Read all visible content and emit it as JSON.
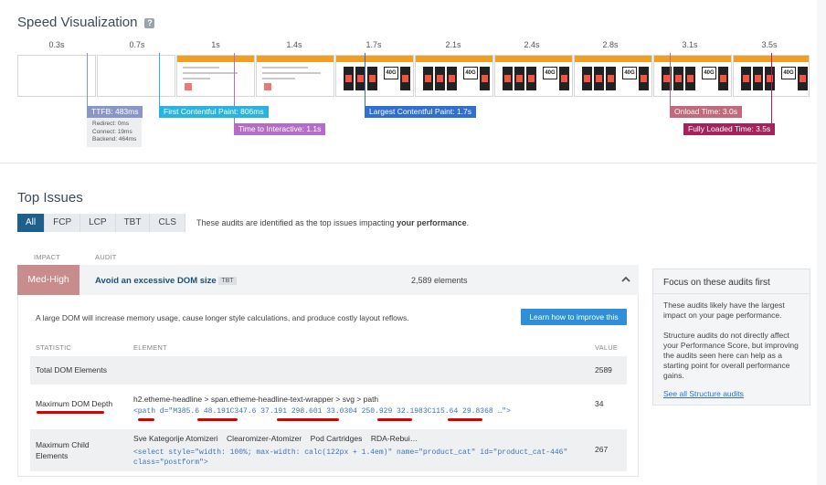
{
  "speed": {
    "title": "Speed Visualization",
    "help": "?",
    "ticks": [
      "0.3s",
      "0.7s",
      "1s",
      "1.4s",
      "1.7s",
      "2.1s",
      "2.4s",
      "2.8s",
      "3.1s",
      "3.5s"
    ],
    "ttfb": {
      "label": "TTFB: 483ms",
      "redirect": "Redirect: 0ms",
      "connect": "Connect: 19ms",
      "backend": "Backend: 464ms",
      "color": "#8a95c8"
    },
    "fcp": {
      "label": "First Contentful Paint: 806ms",
      "color": "#29b3e0"
    },
    "tti": {
      "label": "Time to Interactive: 1.1s",
      "color": "#b56cc8"
    },
    "lcp": {
      "label": "Largest Contentful Paint: 1.7s",
      "color": "#2f6fd1"
    },
    "onload": {
      "label": "Onload Time: 3.0s",
      "color": "#c26a7c"
    },
    "fully": {
      "label": "Fully Loaded Time: 3.5s",
      "color": "#a5235a"
    },
    "frame_tag": "40G"
  },
  "issues": {
    "title": "Top Issues",
    "tabs": [
      "All",
      "FCP",
      "LCP",
      "TBT",
      "CLS"
    ],
    "desc_prefix": "These audits are identified as the top issues impacting ",
    "desc_bold": "your performance",
    "desc_suffix": ".",
    "col_impact": "IMPACT",
    "col_audit": "AUDIT",
    "audit": {
      "impact": "Med-High",
      "impact_color": "#c98c8c",
      "name": "Avoid an excessive DOM size",
      "badge": "TBT",
      "elements": "2,589 elements",
      "explanation": "A large DOM will increase memory usage, cause longer style calculations, and produce costly layout reflows.",
      "learn_button": "Learn how to improve this",
      "col_statistic": "STATISTIC",
      "col_element": "ELEMENT",
      "col_value": "VALUE",
      "rows": [
        {
          "stat": "Total DOM Elements",
          "element": "",
          "code": "",
          "value": "2589"
        },
        {
          "stat": "Maximum DOM Depth",
          "element": "h2.etheme-headline > span.etheme-headline-text-wrapper > svg > path",
          "code": "<path d=\"M385.6 48.191C347.6 37.191 298.601 33.0304 250.929 32.1983C115.64 29.8368 …\">",
          "value": "34"
        },
        {
          "stat": "Maximum Child Elements",
          "element": "Sve Kategorije Atomizeri    Clearomizer-Atomizer    Pod Cartridges    RDA-Rebui…",
          "code": "<select style=\"width: 100%; max-width: calc(122px + 1.4em)\" name=\"product_cat\" id=\"product_cat-446\" class=\"postform\">",
          "value": "267"
        }
      ]
    }
  },
  "sidebar": {
    "title": "Focus on these audits first",
    "p1": "These audits likely have the largest impact on your page performance.",
    "p2": "Structure audits do not directly affect your Performance Score, but improving the audits seen here can help as a starting point for overall performance gains.",
    "link": "See all Structure audits"
  }
}
